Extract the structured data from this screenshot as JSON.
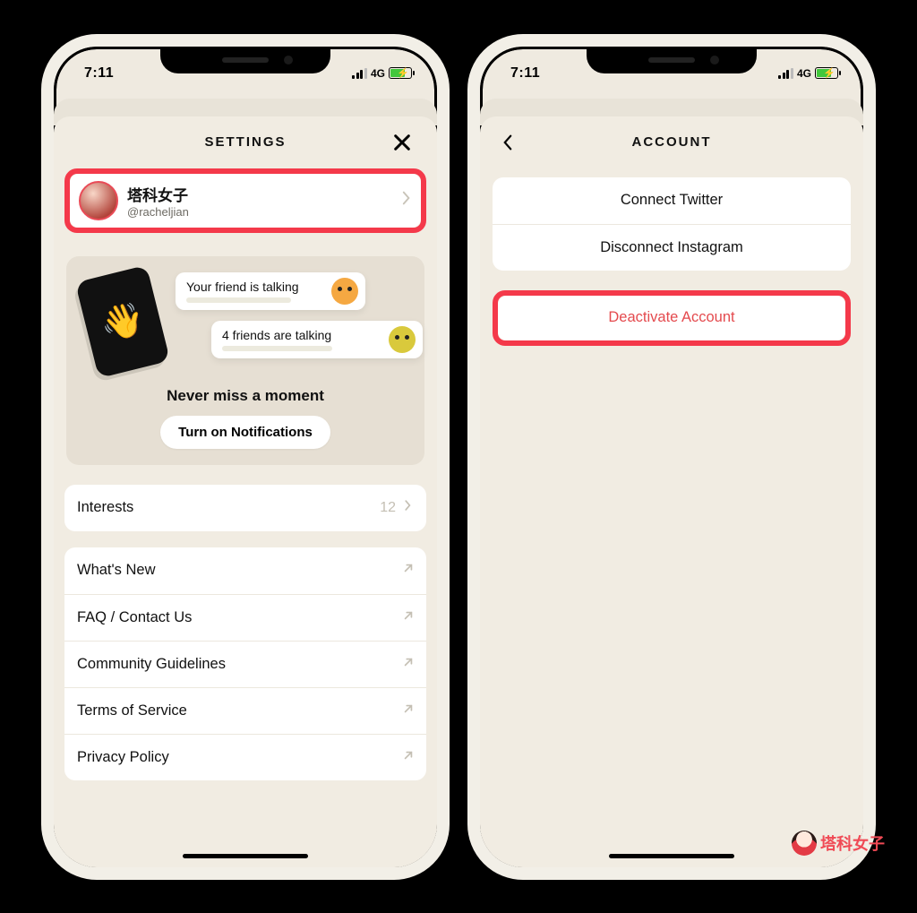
{
  "status": {
    "time": "7:11",
    "net": "4G"
  },
  "left": {
    "title": "SETTINGS",
    "profile": {
      "name": "塔科女子",
      "handle": "@racheljian"
    },
    "promo": {
      "bubble1": "Your friend is talking",
      "bubble2": "4 friends are talking",
      "headline": "Never miss a moment",
      "cta": "Turn on Notifications"
    },
    "interests": {
      "label": "Interests",
      "count": "12"
    },
    "links": {
      "whatsnew": "What's New",
      "faq": "FAQ / Contact Us",
      "guidelines": "Community Guidelines",
      "tos": "Terms of Service",
      "privacy": "Privacy Policy"
    }
  },
  "right": {
    "title": "ACCOUNT",
    "connect_twitter": "Connect Twitter",
    "disconnect_instagram": "Disconnect Instagram",
    "deactivate": "Deactivate Account"
  },
  "watermark": "塔科女子"
}
